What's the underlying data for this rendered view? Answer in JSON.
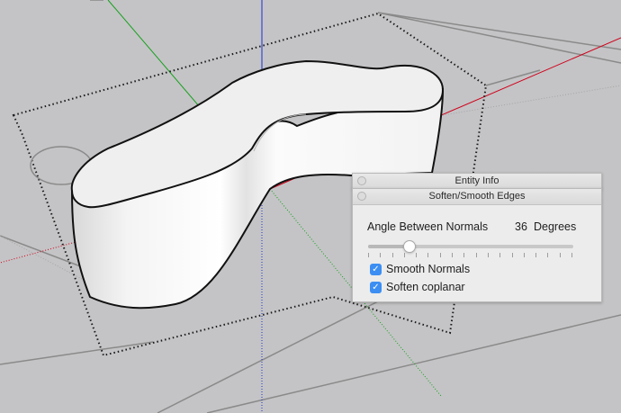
{
  "entity_info": {
    "title": "Entity Info"
  },
  "soften_panel": {
    "title": "Soften/Smooth Edges",
    "angle_label": "Angle Between Normals",
    "angle_value": "36",
    "angle_unit": "Degrees",
    "slider_level": 0.2,
    "smooth_normals": {
      "label": "Smooth Normals",
      "checked": true
    },
    "soften_coplanar": {
      "label": "Soften coplanar",
      "checked": true
    }
  },
  "colors": {
    "accent": "#3c8ef3",
    "canvas_bg": "#c4c4c6",
    "axis_red": "#d0021b",
    "axis_green": "#14a01b",
    "axis_blue": "#1b2fd1"
  }
}
